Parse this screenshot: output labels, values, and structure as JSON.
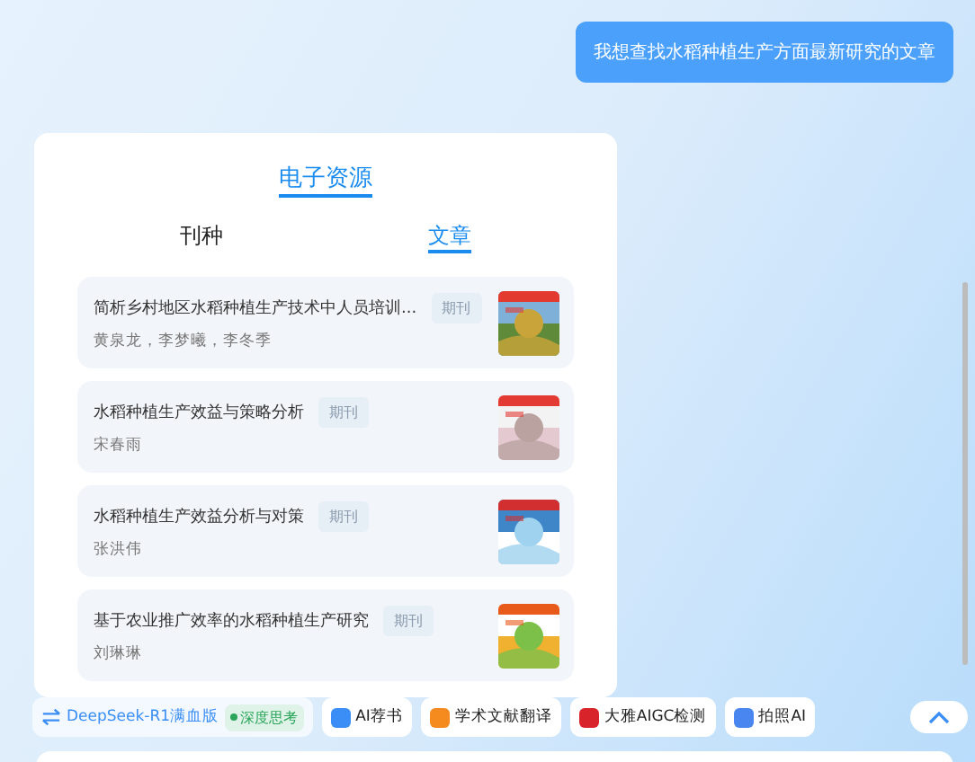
{
  "chat": {
    "user_message": "我想查找水稻种植生产方面最新研究的文章"
  },
  "resource_card": {
    "title": "电子资源",
    "tabs": [
      {
        "label": "刊种",
        "selected": false
      },
      {
        "label": "文章",
        "selected": true
      }
    ],
    "articles": [
      {
        "title": "简析乡村地区水稻种植生产技术中人员培训...",
        "tag": "期刊",
        "authors": "黄泉龙，李梦曦，李冬季"
      },
      {
        "title": "水稻种植生产效益与策略分析",
        "tag": "期刊",
        "authors": "宋春雨"
      },
      {
        "title": "水稻种植生产效益分析与对策",
        "tag": "期刊",
        "authors": "张洪伟"
      },
      {
        "title": "基于农业推广效率的水稻种植生产研究",
        "tag": "期刊",
        "authors": "刘琳琳"
      }
    ]
  },
  "toolbar": {
    "items": [
      {
        "kind": "model",
        "label": "DeepSeek-R1满血版",
        "badge": "深度思考"
      },
      {
        "kind": "tool",
        "label": "AI荐书",
        "color": "#3a8ef6"
      },
      {
        "kind": "tool",
        "label": "学术文献翻译",
        "color": "#f58a1f"
      },
      {
        "kind": "tool",
        "label": "大雅AIGC检测",
        "color": "#d8232a"
      },
      {
        "kind": "tool",
        "label": "拍照AI",
        "color": "#4a86f0"
      }
    ]
  }
}
